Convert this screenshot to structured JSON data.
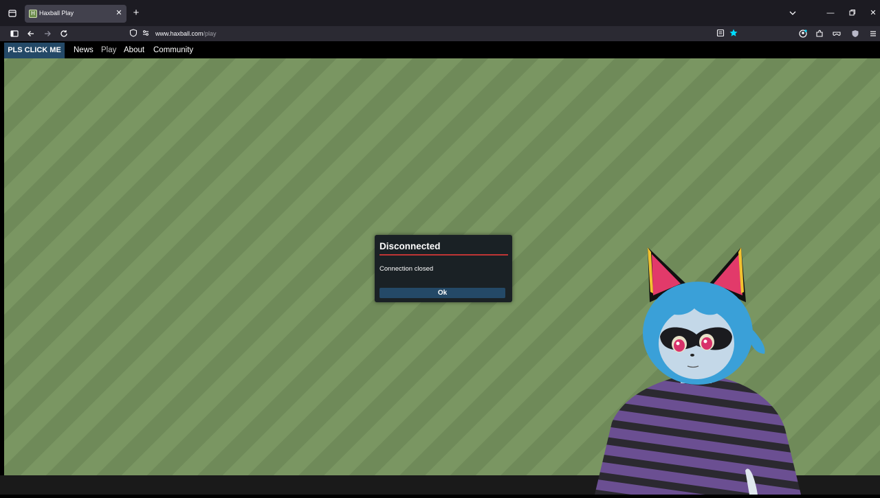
{
  "browser": {
    "tab": {
      "title": "Haxball Play",
      "favicon": "H"
    },
    "url": {
      "host": "www.haxball.com",
      "path": "/play"
    },
    "icons": [
      "tab-list-icon",
      "new-tab-icon",
      "list-tabs-icon",
      "minimize-icon",
      "restore-icon",
      "close-window-icon",
      "sidebar-icon",
      "back-icon",
      "forward-icon",
      "reload-icon",
      "shield-icon",
      "permissions-icon",
      "reader-view-icon",
      "bookmark-star-icon",
      "account-icon",
      "extensions-icon",
      "mask-icon",
      "ublock-icon",
      "menu-icon"
    ],
    "accent": "#00ddff"
  },
  "site": {
    "brand": "PLS CLICK ME",
    "nav": [
      {
        "label": "News"
      },
      {
        "label": "Play",
        "active": true
      },
      {
        "label": "About"
      },
      {
        "label": "Community"
      }
    ],
    "brand_color": "#244967"
  },
  "dialog": {
    "title": "Disconnected",
    "message": "Connection closed",
    "ok_label": "Ok",
    "rule_color": "#c13535"
  }
}
